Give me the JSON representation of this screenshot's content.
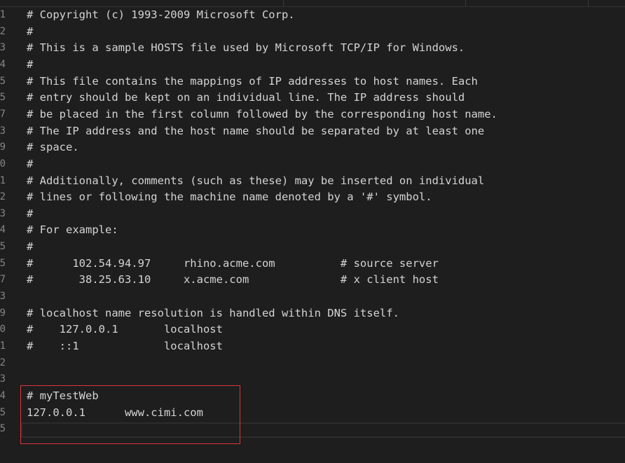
{
  "editor": {
    "lines": [
      {
        "number": "1",
        "text": "# Copyright (c) 1993-2009 Microsoft Corp."
      },
      {
        "number": "2",
        "text": "#"
      },
      {
        "number": "3",
        "text": "# This is a sample HOSTS file used by Microsoft TCP/IP for Windows."
      },
      {
        "number": "4",
        "text": "#"
      },
      {
        "number": "5",
        "text": "# This file contains the mappings of IP addresses to host names. Each"
      },
      {
        "number": "5",
        "text": "# entry should be kept on an individual line. The IP address should"
      },
      {
        "number": "7",
        "text": "# be placed in the first column followed by the corresponding host name."
      },
      {
        "number": "3",
        "text": "# The IP address and the host name should be separated by at least one"
      },
      {
        "number": "9",
        "text": "# space."
      },
      {
        "number": "0",
        "text": "#"
      },
      {
        "number": "1",
        "text": "# Additionally, comments (such as these) may be inserted on individual"
      },
      {
        "number": "2",
        "text": "# lines or following the machine name denoted by a '#' symbol."
      },
      {
        "number": "3",
        "text": "#"
      },
      {
        "number": "4",
        "text": "# For example:"
      },
      {
        "number": "5",
        "text": "#"
      },
      {
        "number": "5",
        "text": "#      102.54.94.97     rhino.acme.com          # source server"
      },
      {
        "number": "7",
        "text": "#       38.25.63.10     x.acme.com              # x client host"
      },
      {
        "number": "3",
        "text": ""
      },
      {
        "number": "9",
        "text": "# localhost name resolution is handled within DNS itself."
      },
      {
        "number": "0",
        "text": "#    127.0.0.1       localhost"
      },
      {
        "number": "1",
        "text": "#    ::1             localhost"
      },
      {
        "number": "2",
        "text": ""
      },
      {
        "number": "3",
        "text": ""
      },
      {
        "number": "4",
        "text": "# myTestWeb"
      },
      {
        "number": "5",
        "text": "127.0.0.1      www.cimi.com"
      },
      {
        "number": "5",
        "text": ""
      }
    ]
  },
  "colors": {
    "background": "#1e1e1e",
    "text": "#d4d4d4",
    "line_number": "#858585",
    "highlight_box": "#d9363e"
  }
}
